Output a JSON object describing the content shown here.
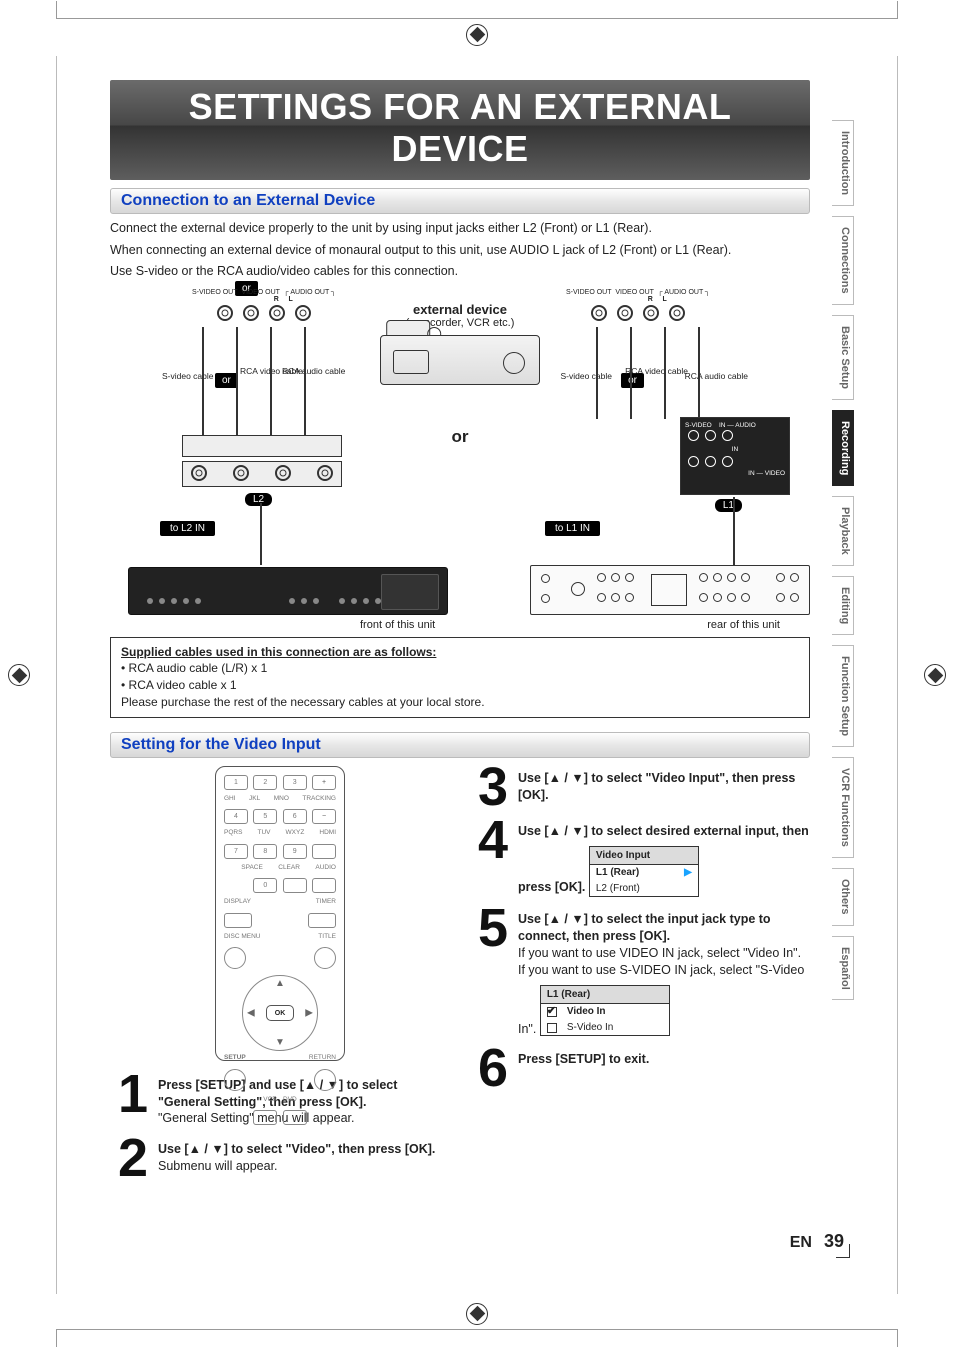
{
  "page": {
    "title_banner": "SETTINGS FOR AN EXTERNAL DEVICE",
    "page_lang": "EN",
    "page_number": "39"
  },
  "tabs": [
    "Introduction",
    "Connections",
    "Basic Setup",
    "Recording",
    "Playback",
    "Editing",
    "Function Setup",
    "VCR Functions",
    "Others",
    "Español"
  ],
  "active_tab": "Recording",
  "section1": {
    "heading": "Connection to an External Device",
    "p1": "Connect the external device properly to the unit by using input jacks either L2 (Front) or L1 (Rear).",
    "p2": "When connecting an external device of monaural output to this unit, use AUDIO L jack of L2 (Front) or L1 (Rear).",
    "p3": "Use S-video or the RCA audio/video cables for this connection."
  },
  "diagram": {
    "ext_device_title": "external device",
    "ext_device_sub": "(camcorder, VCR etc.)",
    "or_small": "or",
    "or_big": "or",
    "labels": {
      "svideo_out": "S-VIDEO OUT",
      "video_out": "VIDEO OUT",
      "audio_out": "AUDIO OUT",
      "audio_r": "R",
      "audio_l": "L",
      "svideo_cable": "S-video cable",
      "rca_video_cable": "RCA video cable",
      "rca_audio_cable": "RCA audio cable",
      "to_l2": "to L2 IN",
      "to_l1": "to L1 IN",
      "l2": "L2",
      "l1": "L1",
      "front_caption": "front of this unit",
      "rear_caption": "rear of this unit",
      "rear_block": {
        "svideo": "S-VIDEO",
        "in_audio": "IN — AUDIO",
        "in": "IN",
        "in_video": "IN — VIDEO"
      }
    }
  },
  "supplied": {
    "heading": "Supplied cables used in this connection are as follows:",
    "line1": "• RCA audio cable (L/R) x 1",
    "line2": "• RCA video cable x 1",
    "line3": "Please purchase the rest of the necessary cables at your local store."
  },
  "section2": {
    "heading": "Setting for the Video Input"
  },
  "remote": {
    "numpad": [
      [
        "1",
        "2",
        "3",
        "+"
      ],
      [
        "4",
        "5",
        "6",
        "−"
      ],
      [
        "7",
        "8",
        "9",
        ""
      ]
    ],
    "row_sub": [
      "GHI",
      "JKL",
      "MNO",
      "TRACKING"
    ],
    "row_sub2": [
      "PQRS",
      "TUV",
      "WXYZ",
      "HDMI"
    ],
    "row3": [
      "",
      "0",
      "",
      ""
    ],
    "row3_sub": [
      "",
      "SPACE",
      "CLEAR",
      "AUDIO"
    ],
    "display": "DISPLAY",
    "timer": "TIMER",
    "disc_menu": "DISC MENU",
    "title": "TITLE",
    "setup": "SETUP",
    "return": "RETURN",
    "ok": "OK",
    "vcr": "VCR",
    "dvd": "DVD"
  },
  "steps": {
    "s1_bold": "Press [SETUP] and use [▲ / ▼] to select \"General Setting\", then press [OK].",
    "s1_sub": "\"General Setting\" menu will appear.",
    "s2_bold": "Use [▲ / ▼] to select \"Video\", then press [OK].",
    "s2_sub": "Submenu will appear.",
    "s3_bold": "Use [▲ / ▼] to select \"Video Input\", then press [OK].",
    "s4_bold": "Use [▲ / ▼] to select desired external input, then press [OK].",
    "s4_menu_header": "Video Input",
    "s4_menu_items": [
      "L1 (Rear)",
      "L2 (Front)"
    ],
    "s5_bold": "Use [▲ / ▼] to select the input jack type to connect, then press [OK].",
    "s5_l1": "If you want to use VIDEO IN jack, select \"Video In\".",
    "s5_l2": " If you want to use S-VIDEO IN jack, select \"S-Video In\".",
    "s5_menu_header": "L1 (Rear)",
    "s5_menu_items": [
      "Video In",
      "S-Video In"
    ],
    "s6_bold": "Press [SETUP] to exit."
  }
}
